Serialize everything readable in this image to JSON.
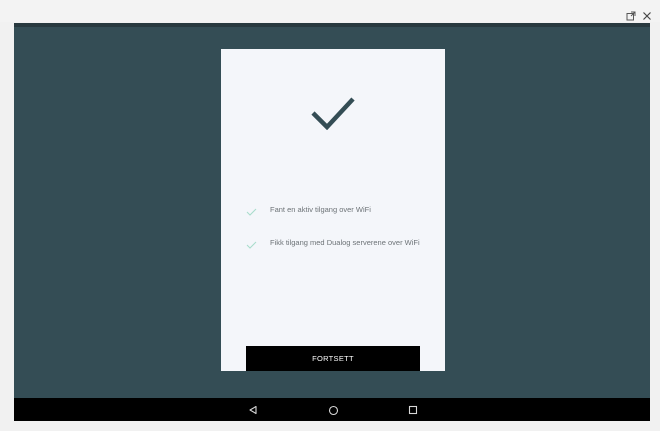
{
  "window": {
    "controls": [
      {
        "icon": "external-window-icon"
      },
      {
        "icon": "close-icon"
      }
    ]
  },
  "colors": {
    "screen_background": "#344d55",
    "card_background": "#f4f6fa",
    "big_check": "#344d55",
    "small_check": "#a7dccb",
    "button_background": "#000000",
    "button_text": "#ffffff",
    "nav_bar": "#000000"
  },
  "card": {
    "header_icon": "checkmark-icon",
    "items": [
      {
        "icon": "check-icon",
        "text": "Fant en aktiv tilgang over WiFi"
      },
      {
        "icon": "check-icon",
        "text": "Fikk tilgang med Dualog serverene over WiFi"
      }
    ],
    "continue_label": "FORTSETT"
  },
  "nav": {
    "buttons": [
      {
        "icon": "back-triangle-icon"
      },
      {
        "icon": "home-circle-icon"
      },
      {
        "icon": "recents-square-icon"
      }
    ]
  }
}
